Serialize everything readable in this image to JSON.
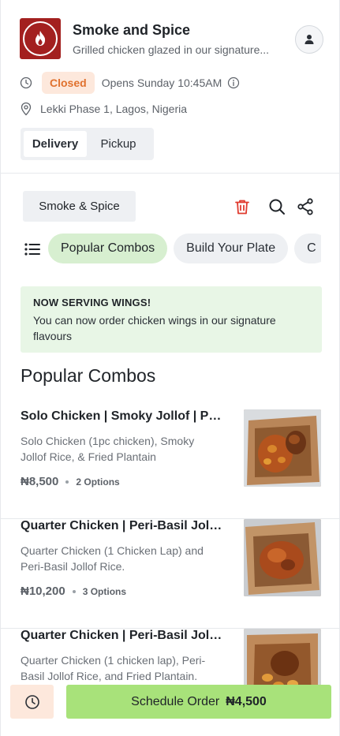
{
  "store": {
    "name": "Smoke and Spice",
    "tagline": "Grilled chicken glazed in our signature...",
    "status": "Closed",
    "opens": "Opens Sunday 10:45AM",
    "address": "Lekki Phase 1, Lagos, Nigeria",
    "brand_color": "#a3201f"
  },
  "mode": {
    "options": [
      "Delivery",
      "Pickup"
    ],
    "selected": "Delivery"
  },
  "menu_bar": {
    "menu_name": "Smoke & Spice",
    "icons": [
      "trash-icon",
      "search-icon",
      "share-icon"
    ]
  },
  "categories": {
    "items": [
      "Popular Combos",
      "Build Your Plate",
      "C"
    ],
    "selected": "Popular Combos"
  },
  "notice": {
    "title": "NOW SERVING WINGS!",
    "body": "You can now order chicken wings in our signature flavours"
  },
  "section": {
    "title": "Popular Combos"
  },
  "items": [
    {
      "name": "Solo Chicken | Smoky Jollof | Pla...",
      "description": "Solo Chicken (1pc chicken), Smoky Jollof Rice, & Fried Plantain",
      "price": "₦8,500",
      "options": "2 Options"
    },
    {
      "name": "Quarter Chicken | Peri-Basil Jollof",
      "description": "Quarter Chicken (1 Chicken Lap) and Peri-Basil Jollof Rice.",
      "price": "₦10,200",
      "options": "3 Options"
    },
    {
      "name": "Quarter Chicken | Peri-Basil Jollo...",
      "description": "Quarter Chicken (1 chicken lap), Peri-Basil Jollof Rice, and Fried Plantain.",
      "price": "",
      "options": ""
    }
  ],
  "bottom_bar": {
    "schedule_label": "Schedule Order",
    "schedule_price": "₦4,500",
    "accent_color": "#a8e27a",
    "closed_color": "#e0712e"
  }
}
